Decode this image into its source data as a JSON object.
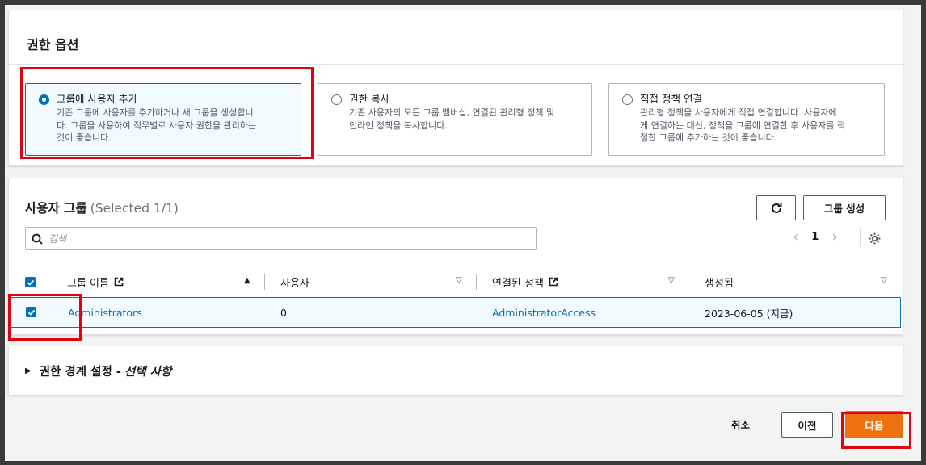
{
  "permission_options": {
    "title": "권한 옵션",
    "options": [
      {
        "label": "그룹에 사용자 추가",
        "description_lines": [
          "기존 그룹에 사용자를 추가하거나 새 그룹을 생성합니",
          "다. 그룹을 사용하여 직무별로 사용자 권한을 관리하는",
          "것이 좋습니다."
        ],
        "selected": true
      },
      {
        "label": "권한 복사",
        "description_lines": [
          "기존 사용자의 모든 그룹 멤버십, 연결된 관리형 정책 및",
          "인라인 정책을 복사합니다."
        ],
        "selected": false
      },
      {
        "label": "직접 정책 연결",
        "description_lines": [
          "관리형 정책을 사용자에게 직접 연결합니다. 사용자에",
          "게 연결하는 대신, 정책을 그룹에 연결한 후 사용자를 적",
          "절한 그룹에 추가하는 것이 좋습니다."
        ],
        "selected": false
      }
    ]
  },
  "user_groups": {
    "title": "사용자 그룹",
    "selected_count": "(Selected 1/1)",
    "create_group_label": "그룹 생성",
    "search_placeholder": "검색",
    "page_number": "1",
    "columns": {
      "group_name": "그룹 이름",
      "users": "사용자",
      "attached_policies": "연결된 정책",
      "created": "생성됨"
    },
    "rows": [
      {
        "group_name": "Administrators",
        "users": "0",
        "attached_policies": "AdministratorAccess",
        "created": "2023-06-05 (지금)",
        "checked": true
      }
    ]
  },
  "permissions_boundary": {
    "label": "권한 경계 설정 -",
    "optional": "선택 사항"
  },
  "footer": {
    "cancel_label": "취소",
    "previous_label": "이전",
    "next_label": "다음"
  },
  "colors": {
    "accent": "#0073bb",
    "primary_button": "#ec7211",
    "highlight_box": "#e3000f"
  }
}
